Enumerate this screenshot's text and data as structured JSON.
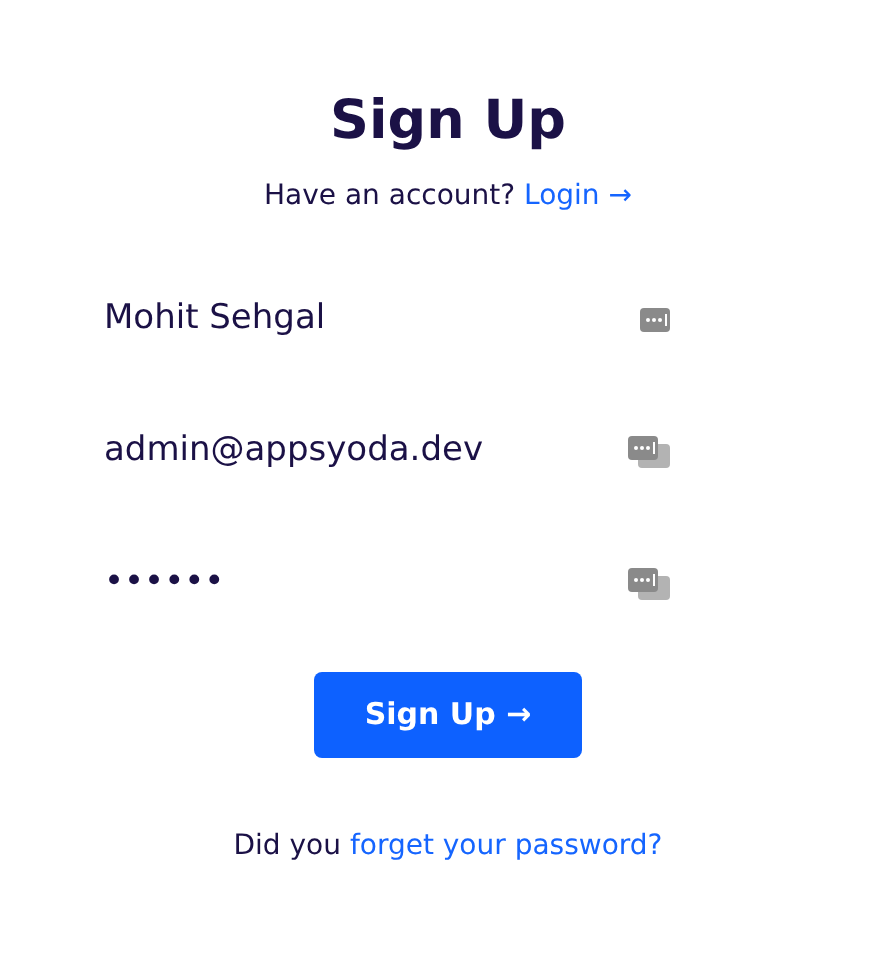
{
  "title": "Sign Up",
  "login_prompt": {
    "text": "Have an account?",
    "link": "Login →"
  },
  "fields": [
    {
      "value": "Mohit Sehgal"
    },
    {
      "value": "admin@appsyoda.dev"
    },
    {
      "value": "••••••"
    }
  ],
  "submit_button": "Sign Up →",
  "forgot_prompt": {
    "text": "Did you",
    "link": "forget your password?"
  }
}
